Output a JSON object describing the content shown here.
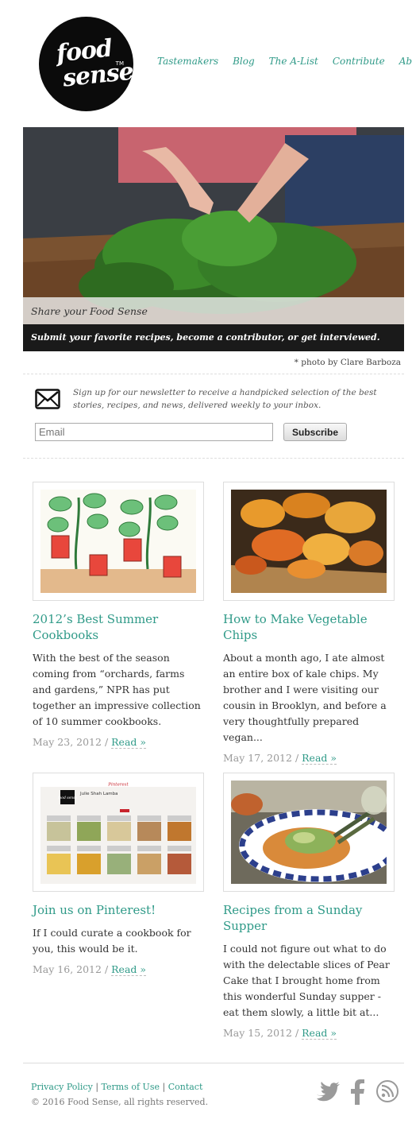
{
  "logo": {
    "line1": "food",
    "line2": "sense",
    "tm": "TM"
  },
  "nav": [
    "Tastemakers",
    "Blog",
    "The A-List",
    "Contribute",
    "About"
  ],
  "hero": {
    "caption": "Share your Food Sense",
    "subcaption": "Submit your favorite recipes, become a contributor, or get interviewed.",
    "credit": "* photo by Clare Barboza"
  },
  "newsletter": {
    "text": "Sign up for our newsletter to receive a handpicked selection of the best stories, recipes, and news, delivered weekly to your inbox.",
    "placeholder": "Email",
    "button": "Subscribe"
  },
  "posts": [
    {
      "title": "2012’s Best Summer Cookbooks",
      "excerpt": "With the best of the season coming from “orchards, farms and gardens,” NPR has put together an impressive collection of 10 summer cookbooks.",
      "date": "May 23, 2012",
      "read": "Read »"
    },
    {
      "title": "How to Make Vegetable Chips",
      "excerpt": "About a month ago, I ate almost an entire box of kale chips. My brother and I were visiting our cousin in Brooklyn, and before a very thoughtfully prepared vegan...",
      "date": "May 17, 2012",
      "read": "Read »"
    },
    {
      "title": "Join us on Pinterest!",
      "excerpt": "If I could curate a cookbook for you, this would be it.",
      "date": "May 16, 2012",
      "read": "Read »"
    },
    {
      "title": "Recipes from a Sunday Supper",
      "excerpt": "I could not figure out what to do with the delectable slices of Pear Cake that I brought home from this wonderful Sunday supper - eat them slowly, a little bit at...",
      "date": "May 15, 2012",
      "read": "Read »"
    }
  ],
  "pinterest_thumb": {
    "brand": "Pinterest",
    "name": "Julie Shah Lamba",
    "logo_small": "food sense"
  },
  "footer": {
    "links": [
      "Privacy Policy",
      "Terms of Use",
      "Contact"
    ],
    "separator": "|",
    "copyright": "© 2016 Food Sense, all rights reserved."
  },
  "date_sep": "/",
  "colors": {
    "accent": "#2f9a88",
    "dark": "#1a1a1a"
  },
  "social_icons": [
    "twitter-icon",
    "facebook-icon",
    "rss-icon"
  ]
}
